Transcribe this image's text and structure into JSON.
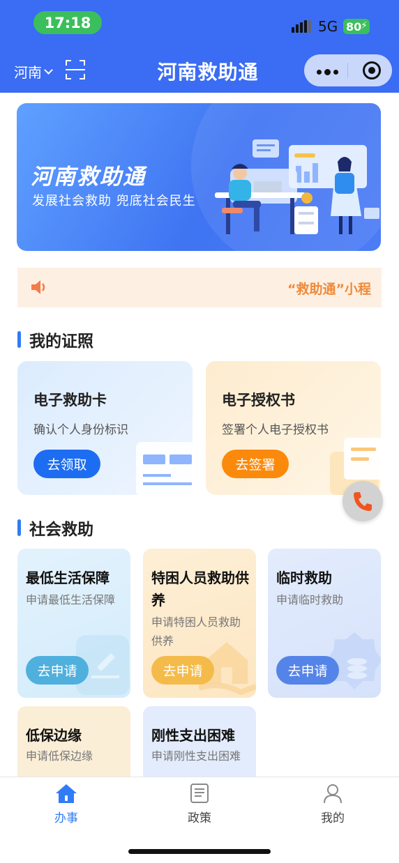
{
  "status_bar": {
    "time": "17:18",
    "network": "5G",
    "battery": "80"
  },
  "header": {
    "region": "河南",
    "title": "河南救助通"
  },
  "banner": {
    "title": "河南救助通",
    "subtitle": "发展社会救助  兜底社会民生"
  },
  "notice": {
    "text": "“救助通”小程"
  },
  "my_licenses": {
    "title": "我的证照",
    "cards": [
      {
        "title": "电子救助卡",
        "desc": "确认个人身份标识",
        "button": "去领取"
      },
      {
        "title": "电子授权书",
        "desc": "签署个人电子授权书",
        "button": "去签署"
      }
    ]
  },
  "social_relief": {
    "title": "社会救助",
    "cards": [
      {
        "title": "最低生活保障",
        "desc": "申请最低生活保障",
        "button": "去申请"
      },
      {
        "title": "特困人员救助供养",
        "desc": "申请特困人员救助供养",
        "button": "去申请"
      },
      {
        "title": "临时救助",
        "desc": "申请临时救助",
        "button": "去申请"
      },
      {
        "title": "低保边缘",
        "desc": "申请低保边缘"
      },
      {
        "title": "刚性支出困难",
        "desc": "申请刚性支出困难"
      }
    ]
  },
  "tabbar": {
    "tabs": [
      {
        "label": "办事",
        "icon": "home-icon",
        "active": true
      },
      {
        "label": "政策",
        "icon": "document-icon",
        "active": false
      },
      {
        "label": "我的",
        "icon": "person-icon",
        "active": false
      }
    ]
  },
  "colors": {
    "header_bg": "#3a6cf4",
    "accent_blue": "#2f7cf6",
    "accent_orange": "#fb8a0c"
  }
}
